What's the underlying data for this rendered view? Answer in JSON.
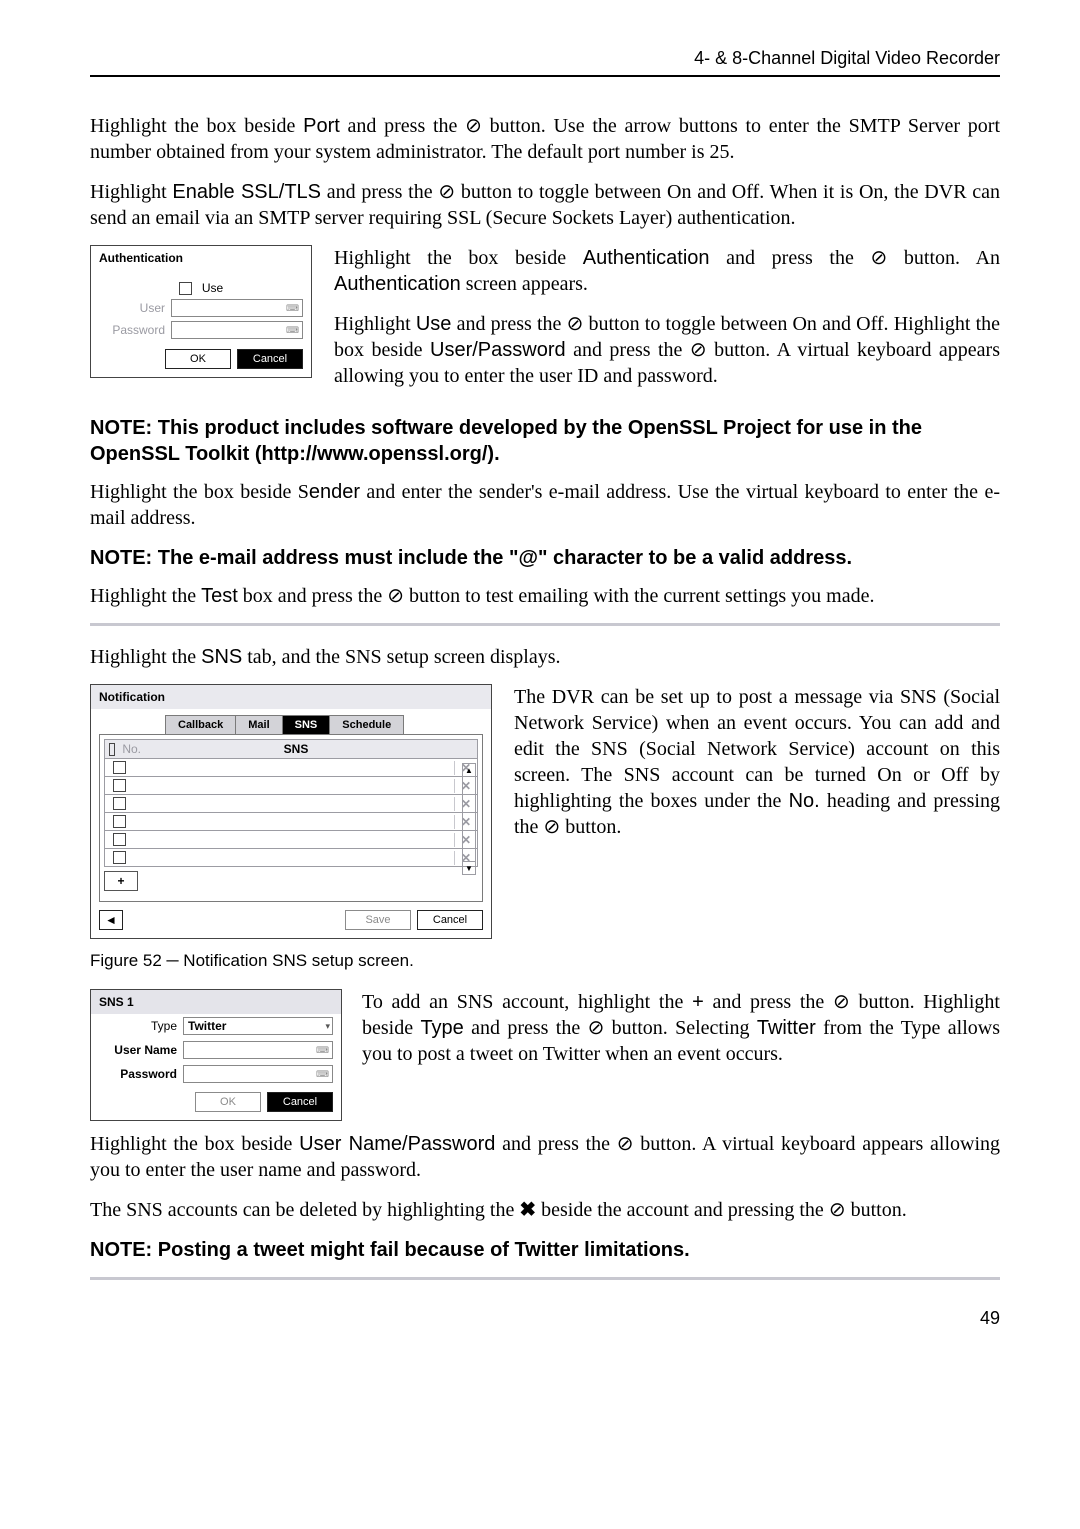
{
  "header": "4- & 8-Channel Digital Video Recorder",
  "pageNumber": "49",
  "p1_a": "Highlight the box beside ",
  "p1_b": "Port",
  "p1_c": " and press the ",
  "p1_d": " button.  Use the arrow buttons to enter the SMTP Server port number obtained from your system administrator.  The default port number is 25.",
  "p2_a": "Highlight ",
  "p2_b": "Enable SSL/TLS",
  "p2_c": " and press the ",
  "p2_d": " button to toggle between On and Off.  When it is On, the DVR can send an email via an SMTP server requiring SSL (Secure Sockets Layer) authentication.",
  "authDlg": {
    "title": "Authentication",
    "useLabel": "Use",
    "userLabel": "User",
    "passwordLabel": "Password",
    "ok": "OK",
    "cancel": "Cancel"
  },
  "auth_side1_a": "Highlight the box beside ",
  "auth_side1_b": "Authentication",
  "auth_side1_c": " and press the ",
  "auth_side1_d": " button.  An ",
  "auth_side1_e": "Authentication",
  "auth_side1_f": " screen appears.",
  "auth_side2_a": "Highlight ",
  "auth_side2_b": "Use",
  "auth_side2_c": " and press the ",
  "auth_side2_d": " button to toggle between On and Off. Highlight the box beside ",
  "auth_side2_e": "User/Password",
  "auth_side2_f": " and press the ",
  "auth_side2_g": " button. A virtual keyboard appears allowing you to enter the user ID and password.",
  "note1": "NOTE:  This product includes software developed by the OpenSSL Project for use in the OpenSSL Toolkit (http://www.openssl.org/).",
  "p3_a": "Highlight the box beside S",
  "p3_b": "ender",
  "p3_c": " and enter the sender's e-mail address.  Use the virtual keyboard to enter the e-mail address.",
  "note2": "NOTE:  The e-mail address must include the \"@\" character to be a valid address.",
  "p4_a": "Highlight the ",
  "p4_b": "Test",
  "p4_c": " box and press the ",
  "p4_d": " button to test emailing with the current settings you made.",
  "p5_a": "Highlight the ",
  "p5_b": "SNS",
  "p5_c": " tab, and the SNS setup screen displays.",
  "notifDlg": {
    "title": "Notification",
    "tabs": {
      "callback": "Callback",
      "mail": "Mail",
      "sns": "SNS",
      "schedule": "Schedule"
    },
    "no": "No.",
    "snsHead": "SNS",
    "plus": "+",
    "save": "Save",
    "cancel": "Cancel"
  },
  "notif_side_a": "The DVR can be set up to post a message via SNS (Social Network Service) when an event occurs.  You can add and edit the SNS (Social Network Service) account on this screen.  The SNS account can be turned On or Off by highlighting the boxes under the ",
  "notif_side_b": "No.",
  "notif_side_c": " heading and pressing the ",
  "notif_side_d": " button.",
  "figCaption": "Figure 52 ─ Notification SNS setup screen.",
  "sns1Dlg": {
    "title": "SNS 1",
    "typeLabel": "Type",
    "typeValue": "Twitter",
    "userLabel": "User Name",
    "passLabel": "Password",
    "ok": "OK",
    "cancel": "Cancel"
  },
  "sns1_side_a": "To add an SNS account, highlight the ",
  "sns1_side_b": "+",
  "sns1_side_c": " and press the ",
  "sns1_side_d": " button. Highlight beside ",
  "sns1_side_e": "Type",
  "sns1_side_f": " and press the ",
  "sns1_side_g": " button.  Selecting ",
  "sns1_side_h": "Twitter",
  "sns1_side_i": " from the Type allows you to post a tweet on Twitter when an event occurs.",
  "p6_a": "Highlight the box beside ",
  "p6_b": "User Name/Password",
  "p6_c": " and press the ",
  "p6_d": " button.  A virtual keyboard appears allowing you to enter the user name and password.",
  "p7_a": "The SNS accounts can be deleted by highlighting the ",
  "p7_b": " beside the account and pressing the ",
  "p7_c": " button.",
  "note3": "NOTE:  Posting a tweet might fail because of Twitter limitations.",
  "icons": {
    "enter": "⊘",
    "x": "✖"
  }
}
